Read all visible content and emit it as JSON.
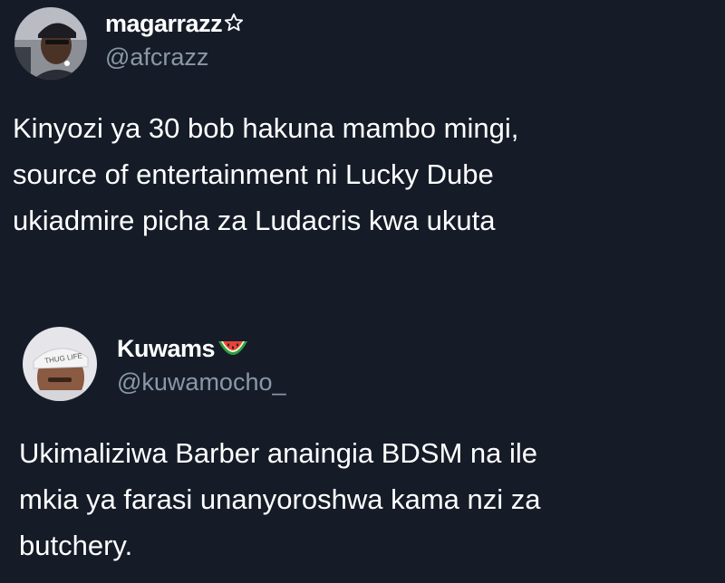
{
  "tweets": [
    {
      "author": {
        "display_name": "magarrazz",
        "display_name_emoji": "star-icon",
        "handle": "@afcrazz"
      },
      "text_lines": [
        "Kinyozi ya 30 bob hakuna mambo mingi,",
        "source of entertainment ni Lucky Dube",
        "ukiadmire picha za Ludacris kwa ukuta"
      ]
    },
    {
      "author": {
        "display_name": "Kuwams",
        "display_name_emoji": "watermelon-icon",
        "handle": "@kuwamocho_"
      },
      "text_lines": [
        "Ukimaliziwa Barber anaingia BDSM na ile",
        "mkia ya farasi unanyoroshwa kama nzi za",
        "butchery."
      ]
    }
  ],
  "colors": {
    "background": "#151c28",
    "text": "#ffffff",
    "handle": "#8a97a6"
  }
}
